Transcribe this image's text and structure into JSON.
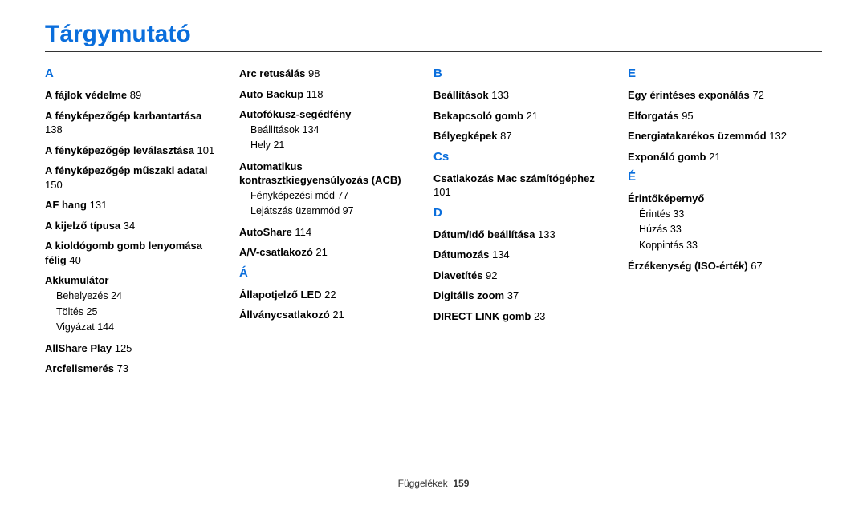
{
  "title": "Tárgymutató",
  "columns": [
    {
      "groups": [
        {
          "letter": "A",
          "entries": [
            {
              "title": "A fájlok védelme",
              "page": "89"
            },
            {
              "title": "A fényképezőgép karbantartása",
              "page": "138"
            },
            {
              "title": "A fényképezőgép leválasztása",
              "page": "101"
            },
            {
              "title": "A fényképezőgép műszaki adatai",
              "page": "150"
            },
            {
              "title": "AF hang",
              "page": "131"
            },
            {
              "title": "A kijelző típusa",
              "page": "34"
            },
            {
              "title": "A kioldógomb gomb lenyomása félig",
              "page": "40"
            },
            {
              "title": "Akkumulátor",
              "page": "",
              "subs": [
                {
                  "label": "Behelyezés",
                  "page": "24"
                },
                {
                  "label": "Töltés",
                  "page": "25"
                },
                {
                  "label": "Vigyázat",
                  "page": "144"
                }
              ]
            },
            {
              "title": "AllShare Play",
              "page": "125"
            },
            {
              "title": "Arcfelismerés",
              "page": "73"
            }
          ]
        }
      ]
    },
    {
      "groups": [
        {
          "letter": "",
          "entries": [
            {
              "title": "Arc retusálás",
              "page": "98"
            },
            {
              "title": "Auto Backup",
              "page": "118"
            },
            {
              "title": "Autofókusz-segédfény",
              "page": "",
              "subs": [
                {
                  "label": "Beállítások",
                  "page": "134"
                },
                {
                  "label": "Hely",
                  "page": "21"
                }
              ]
            },
            {
              "title": "Automatikus kontrasztkiegyensúlyozás (ACB)",
              "page": "",
              "subs": [
                {
                  "label": "Fényképezési mód",
                  "page": "77"
                },
                {
                  "label": "Lejátszás üzemmód",
                  "page": "97"
                }
              ]
            },
            {
              "title": "AutoShare",
              "page": "114"
            },
            {
              "title": "A/V-csatlakozó",
              "page": "21"
            }
          ]
        },
        {
          "letter": "Á",
          "entries": [
            {
              "title": "Állapotjelző LED",
              "page": "22"
            },
            {
              "title": "Állványcsatlakozó",
              "page": "21"
            }
          ]
        }
      ]
    },
    {
      "groups": [
        {
          "letter": "B",
          "entries": [
            {
              "title": "Beállítások",
              "page": "133"
            },
            {
              "title": "Bekapcsoló gomb",
              "page": "21"
            },
            {
              "title": "Bélyegképek",
              "page": "87"
            }
          ]
        },
        {
          "letter": "Cs",
          "entries": [
            {
              "title": "Csatlakozás Mac számítógéphez",
              "page": "101"
            }
          ]
        },
        {
          "letter": "D",
          "entries": [
            {
              "title": "Dátum/Idő beállítása",
              "page": "133"
            },
            {
              "title": "Dátumozás",
              "page": "134"
            },
            {
              "title": "Diavetítés",
              "page": "92"
            },
            {
              "title": "Digitális zoom",
              "page": "37"
            },
            {
              "title": "DIRECT LINK gomb",
              "page": "23"
            }
          ]
        }
      ]
    },
    {
      "groups": [
        {
          "letter": "E",
          "entries": [
            {
              "title": "Egy érintéses exponálás",
              "page": "72"
            },
            {
              "title": "Elforgatás",
              "page": "95"
            },
            {
              "title": "Energiatakarékos üzemmód",
              "page": "132"
            },
            {
              "title": "Exponáló gomb",
              "page": "21"
            }
          ]
        },
        {
          "letter": "É",
          "entries": [
            {
              "title": "Érintőképernyő",
              "page": "",
              "subs": [
                {
                  "label": "Érintés",
                  "page": "33"
                },
                {
                  "label": "Húzás",
                  "page": "33"
                },
                {
                  "label": "Koppintás",
                  "page": "33"
                }
              ]
            },
            {
              "title": "Érzékenység (ISO-érték)",
              "page": "67"
            }
          ]
        }
      ]
    }
  ],
  "footer": {
    "label": "Függelékek",
    "page": "159"
  }
}
